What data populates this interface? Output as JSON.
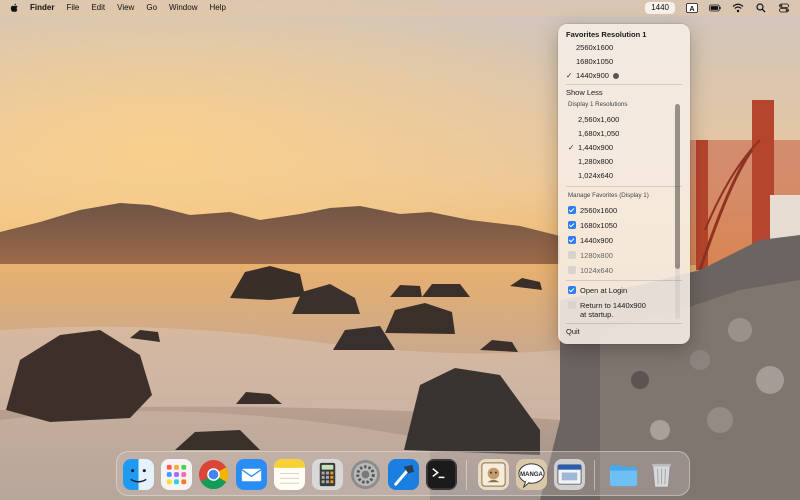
{
  "menubar": {
    "app_name": "Finder",
    "menus": [
      "File",
      "Edit",
      "View",
      "Go",
      "Window",
      "Help"
    ],
    "status_resolution": "1440",
    "status_letter": "A",
    "icons": [
      "apple-icon",
      "keyboard-input-icon",
      "battery-icon",
      "wifi-icon",
      "search-icon",
      "control-center-icon"
    ]
  },
  "panel": {
    "title": "Favorites Resolution 1",
    "favorites": [
      {
        "label": "2560x1600",
        "checked": false
      },
      {
        "label": "1680x1050",
        "checked": false
      },
      {
        "label": "1440x900",
        "checked": true
      }
    ],
    "show_less": "Show Less",
    "display_section": "Display 1 Resolutions",
    "resolutions": [
      {
        "label": "2,560x1,600",
        "checked": false
      },
      {
        "label": "1,680x1,050",
        "checked": false
      },
      {
        "label": "1,440x900",
        "checked": true
      },
      {
        "label": "1,280x800",
        "checked": false
      },
      {
        "label": "1,024x640",
        "checked": false
      }
    ],
    "manage_section": "Manage Favorites (Display 1)",
    "manage": [
      {
        "label": "2560x1600",
        "checked": true
      },
      {
        "label": "1680x1050",
        "checked": true
      },
      {
        "label": "1440x900",
        "checked": true
      },
      {
        "label": "1280x800",
        "checked": false
      },
      {
        "label": "1024x640",
        "checked": false
      }
    ],
    "open_at_login": {
      "label": "Open at Login",
      "checked": true
    },
    "return_startup": {
      "label_line1": "Return to 1440x900",
      "label_line2": "at startup.",
      "checked": false
    },
    "quit": "Quit"
  },
  "dock": {
    "apps": [
      "finder-icon",
      "launchpad-icon",
      "chrome-icon",
      "mail-icon",
      "notes-icon",
      "calculator-icon",
      "system-settings-icon",
      "xcode-icon",
      "terminal-icon",
      "app-icon-one",
      "manga-icon",
      "app-icon-three",
      "downloads-folder-icon",
      "trash-icon"
    ],
    "manga_label": "MANGA"
  },
  "colors": {
    "accent": "#2f7bf0",
    "sky_top": "#d7c7b4",
    "sky_bottom": "#f1b05a",
    "bridge": "#b5452c"
  }
}
